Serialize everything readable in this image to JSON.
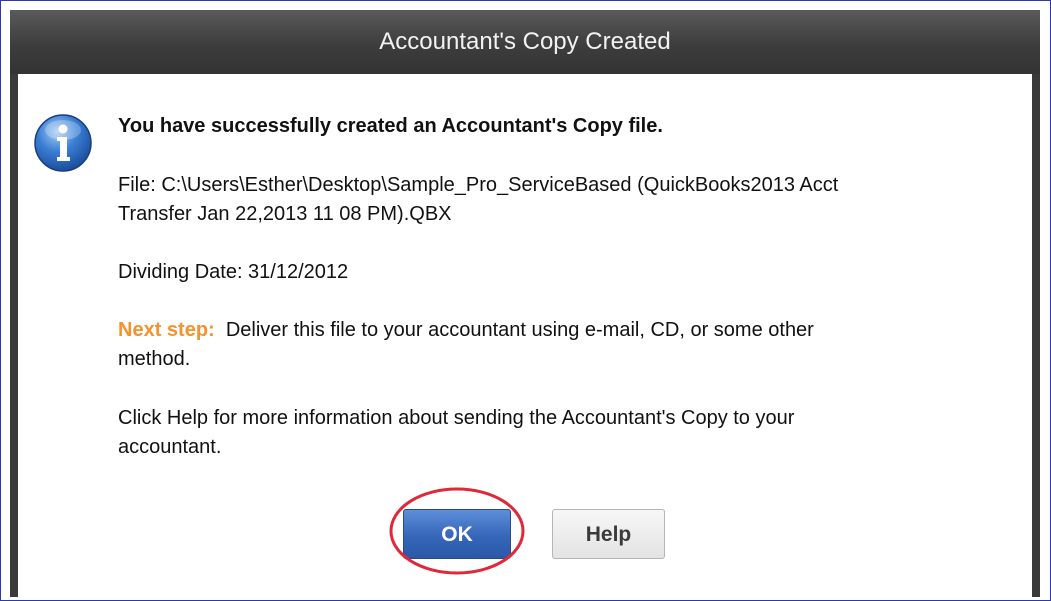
{
  "dialog": {
    "title": "Accountant's Copy Created",
    "headline": "You have successfully created an Accountant's Copy file.",
    "file_line1": "File: C:\\Users\\Esther\\Desktop\\Sample_Pro_ServiceBased (QuickBooks2013 Acct",
    "file_line2": "Transfer Jan 22,2013 11 08 PM).QBX",
    "dividing_date": "Dividing Date: 31/12/2012",
    "next_step_label": "Next step:",
    "next_step_line1": "  Deliver this file to your accountant using e-mail, CD, or some other",
    "next_step_line2": "method.",
    "help_line1": "Click Help for more information about sending the Accountant's Copy to your",
    "help_line2": "accountant.",
    "ok_label": "OK",
    "help_label": "Help",
    "icon": "info-icon",
    "highlight_color": "#e0283a"
  }
}
